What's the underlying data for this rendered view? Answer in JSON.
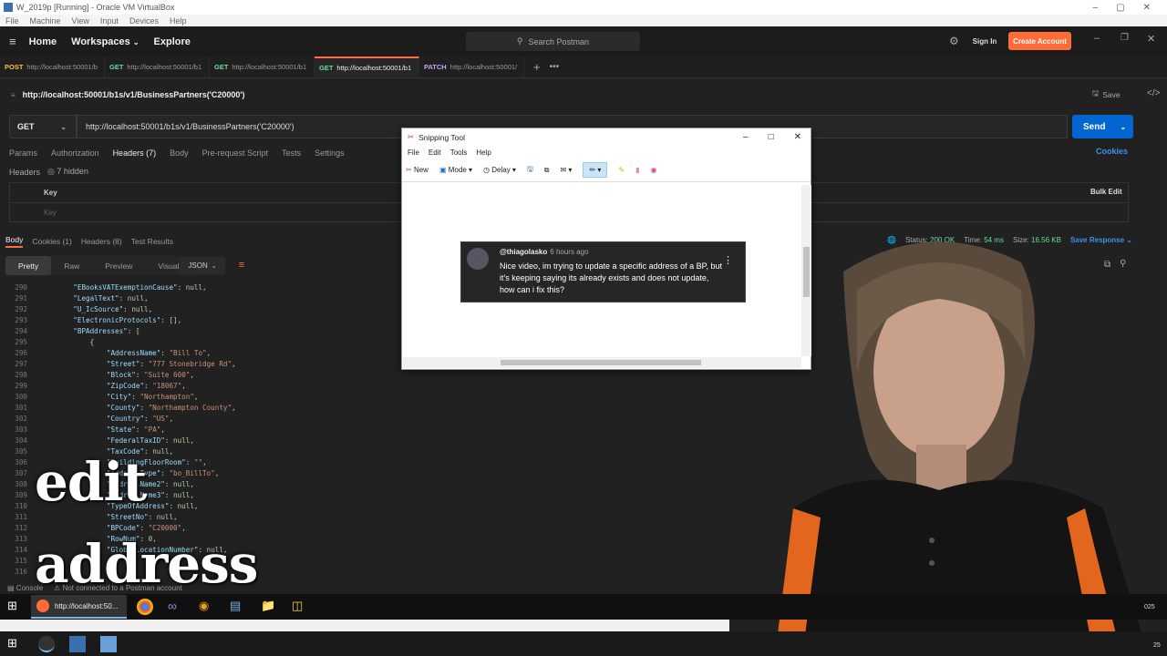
{
  "virtualbox": {
    "title": "W_2019p [Running] - Oracle VM VirtualBox",
    "menu": [
      "File",
      "Machine",
      "View",
      "Input",
      "Devices",
      "Help"
    ]
  },
  "postman": {
    "nav": {
      "home": "Home",
      "workspaces": "Workspaces",
      "explore": "Explore"
    },
    "search_placeholder": "Search Postman",
    "sign_in": "Sign In",
    "create_account": "Create Account",
    "tabs": [
      {
        "method": "POST",
        "label": "http://localhost:50001/b"
      },
      {
        "method": "GET",
        "label": "http://localhost:50001/b1"
      },
      {
        "method": "GET",
        "label": "http://localhost:50001/b1"
      },
      {
        "method": "GET",
        "label": "http://localhost:50001/b1"
      },
      {
        "method": "PATCH",
        "label": "http://localhost:50001/"
      }
    ],
    "request_title": "http://localhost:50001/b1s/v1/BusinessPartners('C20000')",
    "save": "Save",
    "method": "GET",
    "url": "http://localhost:50001/b1s/v1/BusinessPartners('C20000')",
    "send": "Send",
    "request_tabs": [
      "Params",
      "Authorization",
      "Headers (7)",
      "Body",
      "Pre-request Script",
      "Tests",
      "Settings"
    ],
    "cookies": "Cookies",
    "headers_label": "Headers",
    "hidden": "7 hidden",
    "kv_key_header": "Key",
    "kv_key_placeholder": "Key",
    "bulk_edit": "Bulk Edit",
    "response_tabs": [
      "Body",
      "Cookies (1)",
      "Headers (8)",
      "Test Results"
    ],
    "status": {
      "status_label": "Status:",
      "status_value": "200 OK",
      "time_label": "Time:",
      "time_value": "54 ms",
      "size_label": "Size:",
      "size_value": "16.56 KB",
      "save_response": "Save Response"
    },
    "view_tabs": [
      "Pretty",
      "Raw",
      "Preview",
      "Visualize"
    ],
    "format": "JSON",
    "code_lines": [
      {
        "num": "290",
        "text": "    \"EBooksVATExemptionCause\": null,"
      },
      {
        "num": "291",
        "text": "    \"LegalText\": null,"
      },
      {
        "num": "292",
        "text": "    \"U_IcSource\": null,"
      },
      {
        "num": "293",
        "text": "    \"ElectronicProtocols\": [],"
      },
      {
        "num": "294",
        "text": "    \"BPAddresses\": ["
      },
      {
        "num": "295",
        "text": "        {"
      },
      {
        "num": "296",
        "text": "            \"AddressName\": \"Bill To\","
      },
      {
        "num": "297",
        "text": "            \"Street\": \"777 Stonebridge Rd\","
      },
      {
        "num": "298",
        "text": "            \"Block\": \"Suite 600\","
      },
      {
        "num": "299",
        "text": "            \"ZipCode\": \"18067\","
      },
      {
        "num": "300",
        "text": "            \"City\": \"Northampton\","
      },
      {
        "num": "301",
        "text": "            \"County\": \"Northampton County\","
      },
      {
        "num": "302",
        "text": "            \"Country\": \"US\","
      },
      {
        "num": "303",
        "text": "            \"State\": \"PA\","
      },
      {
        "num": "304",
        "text": "            \"FederalTaxID\": null,"
      },
      {
        "num": "305",
        "text": "            \"TaxCode\": null,"
      },
      {
        "num": "306",
        "text": "            \"BuildingFloorRoom\": \"\","
      },
      {
        "num": "307",
        "text": "            \"AddressType\": \"bo_BillTo\","
      },
      {
        "num": "308",
        "text": "            \"AddressName2\": null,"
      },
      {
        "num": "309",
        "text": "            \"AddressName3\": null,"
      },
      {
        "num": "310",
        "text": "            \"TypeOfAddress\": null,"
      },
      {
        "num": "311",
        "text": "            \"StreetNo\": null,"
      },
      {
        "num": "312",
        "text": "            \"BPCode\": \"C20000\","
      },
      {
        "num": "313",
        "text": "            \"RowNum\": 0,"
      },
      {
        "num": "314",
        "text": "            \"GlobalLocationNumber\": null,"
      },
      {
        "num": "315",
        "text": ""
      },
      {
        "num": "316",
        "text": ""
      }
    ],
    "console": "Console",
    "not_connected": "Not connected to a Postman account"
  },
  "overlay": {
    "line1": "edit",
    "line2": "address"
  },
  "snipping_tool": {
    "title": "Snipping Tool",
    "menu": [
      "File",
      "Edit",
      "Tools",
      "Help"
    ],
    "tools": {
      "new": "New",
      "mode": "Mode",
      "delay": "Delay"
    },
    "comment": {
      "user": "@thiagolasko",
      "time": "6 hours ago",
      "body": "Nice video, im trying to update a specific address of a BP, but it's keeping saying its already exists and does not update, how can i fix this?"
    }
  },
  "taskbar": {
    "active_app": "http://localhost:50...",
    "clock_top": "025",
    "clock_bottom": "25"
  },
  "colors": {
    "accent": "#ff6c37",
    "send": "#0265d2",
    "get": "#6bdd9a",
    "post": "#f9c23c",
    "patch": "#c5a5f5"
  }
}
